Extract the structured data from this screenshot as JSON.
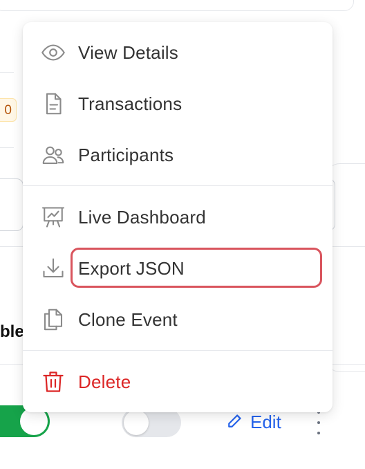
{
  "background": {
    "badge_text": "0",
    "row_fragment_text": "ble",
    "edit_label": "Edit"
  },
  "menu": {
    "items": [
      {
        "label": "View Details",
        "icon": "eye-icon"
      },
      {
        "label": "Transactions",
        "icon": "document-icon"
      },
      {
        "label": "Participants",
        "icon": "users-icon"
      },
      {
        "label": "Live Dashboard",
        "icon": "presentation-chart-icon"
      },
      {
        "label": "Export JSON",
        "icon": "download-icon",
        "highlighted": true
      },
      {
        "label": "Clone Event",
        "icon": "copy-icon"
      },
      {
        "label": "Delete",
        "icon": "trash-icon",
        "danger": true
      }
    ]
  },
  "colors": {
    "accent_blue": "#2563eb",
    "danger_red": "#dc2626",
    "toggle_on_green": "#16a34a",
    "highlight_outline": "#d9545d",
    "icon_gray": "#8a8a8a"
  }
}
